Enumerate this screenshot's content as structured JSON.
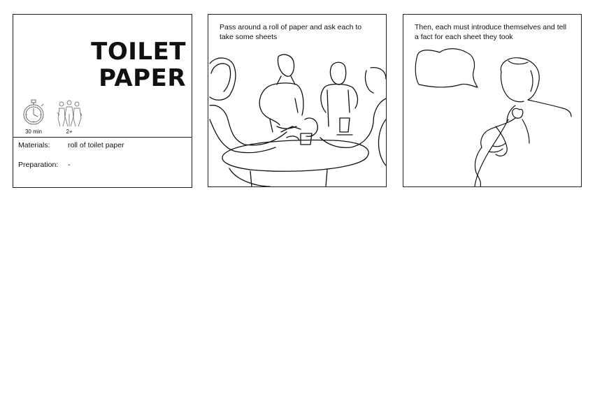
{
  "card1": {
    "title_line1": "TOILET",
    "title_line2": "PAPER",
    "icons": [
      {
        "name": "stopwatch-icon",
        "label": "30 min"
      },
      {
        "name": "people-icon",
        "label": "2+"
      }
    ],
    "materials_label": "Materials:",
    "materials_value": "roll of toilet paper",
    "preparation_label": "Preparation:",
    "preparation_value": "-"
  },
  "card2": {
    "caption": "Pass around a roll of paper and ask each to take some sheets",
    "illustration": "people-around-table-sketch"
  },
  "card3": {
    "caption": "Then, each must introduce themselves and tell a fact for each sheet they took",
    "illustration": "person-speaking-sketch"
  }
}
